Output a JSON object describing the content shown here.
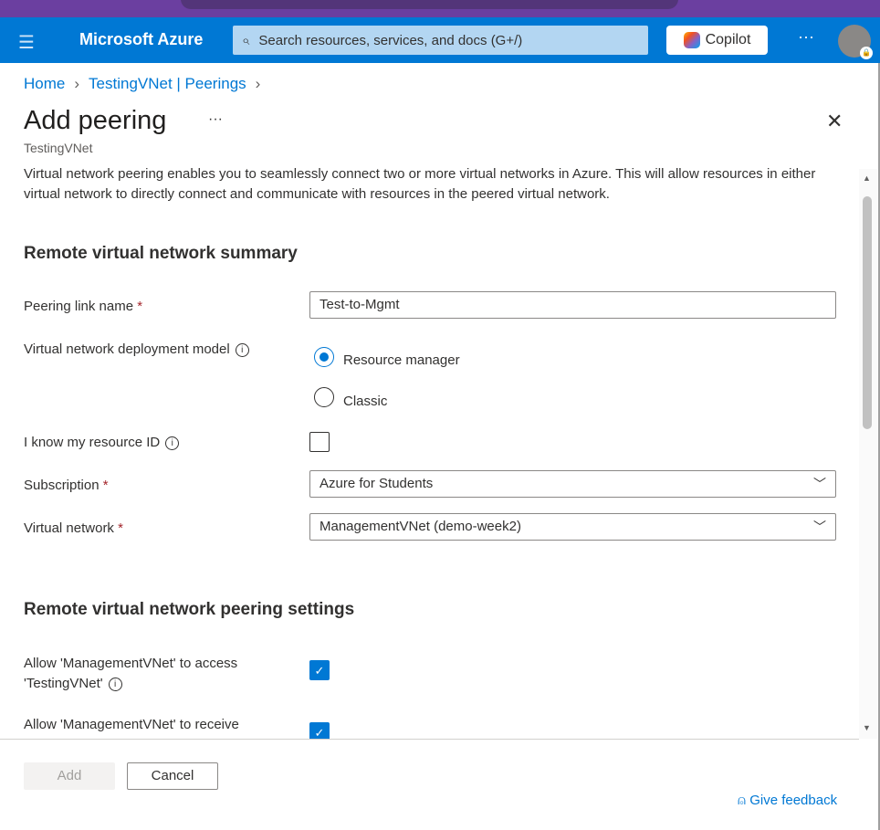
{
  "header": {
    "brand": "Microsoft Azure",
    "search_placeholder": "Search resources, services, and docs (G+/)",
    "copilot_label": "Copilot",
    "more": "···"
  },
  "breadcrumb": [
    {
      "label": "Home"
    },
    {
      "label": "TestingVNet | Peerings"
    }
  ],
  "page": {
    "title": "Add peering",
    "more": "···",
    "subtitle": "TestingVNet",
    "description": "Virtual network peering enables you to seamlessly connect two or more virtual networks in Azure. This will allow resources in either virtual network to directly connect and communicate with resources in the peered virtual network."
  },
  "section1": {
    "heading": "Remote virtual network summary",
    "peering_link_name": {
      "label": "Peering link name",
      "required": "*",
      "value": "Test-to-Mgmt"
    },
    "deployment_model": {
      "label": "Virtual network deployment model",
      "options": [
        {
          "label": "Resource manager",
          "selected": true
        },
        {
          "label": "Classic",
          "selected": false
        }
      ]
    },
    "know_resource_id": {
      "label": "I know my resource ID",
      "checked": false
    },
    "subscription": {
      "label": "Subscription",
      "required": "*",
      "value": "Azure for Students"
    },
    "virtual_network": {
      "label": "Virtual network",
      "required": "*",
      "value": "ManagementVNet (demo-week2)"
    }
  },
  "section2": {
    "heading": "Remote virtual network peering settings",
    "allow_access": {
      "label_line1": "Allow 'ManagementVNet' to access",
      "label_line2": "'TestingVNet'",
      "checked": true
    },
    "allow_receive": {
      "label_line1": "Allow 'ManagementVNet' to receive",
      "checked": true
    }
  },
  "footer": {
    "add_label": "Add",
    "cancel_label": "Cancel",
    "feedback_label": "Give feedback"
  },
  "colors": {
    "accent": "#0078d4",
    "header": "#0078d4",
    "required": "#a4262c"
  }
}
